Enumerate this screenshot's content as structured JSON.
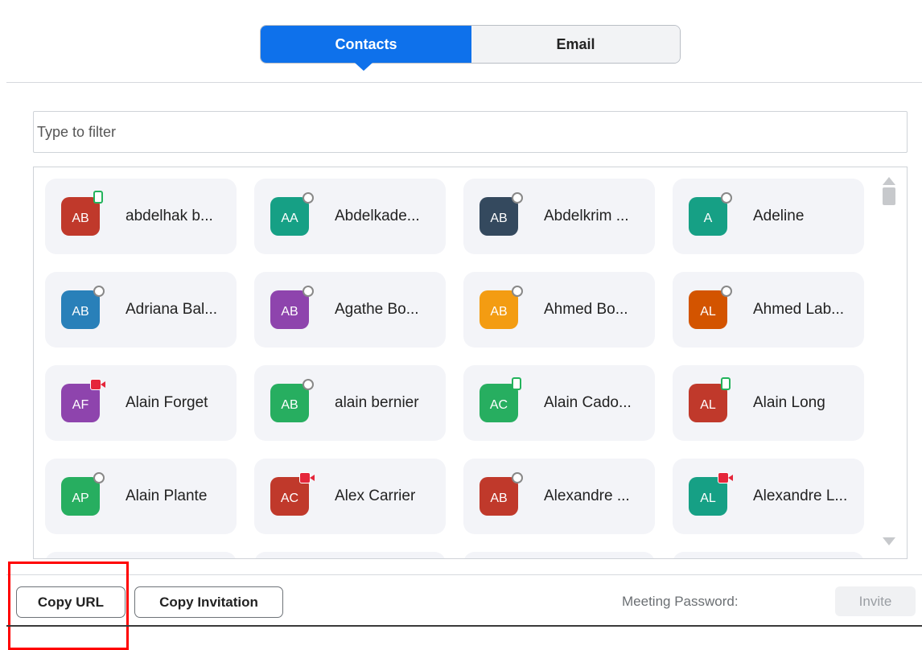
{
  "tabs": [
    {
      "label": "Contacts",
      "active": true
    },
    {
      "label": "Email",
      "active": false
    }
  ],
  "filter": {
    "placeholder": "Type to filter",
    "value": ""
  },
  "contacts": [
    {
      "initials": "AB",
      "name": "abdelhak b...",
      "color": "#c0392b",
      "status": "online"
    },
    {
      "initials": "AA",
      "name": "Abdelkade...",
      "color": "#16a085",
      "status": "offline"
    },
    {
      "initials": "AB",
      "name": "Abdelkrim ...",
      "color": "#34495e",
      "status": "offline"
    },
    {
      "initials": "A",
      "name": "Adeline",
      "color": "#16a085",
      "status": "offline"
    },
    {
      "initials": "AB",
      "name": "Adriana Bal...",
      "color": "#2980b9",
      "status": "offline"
    },
    {
      "initials": "AB",
      "name": "Agathe Bo...",
      "color": "#8e44ad",
      "status": "offline"
    },
    {
      "initials": "AB",
      "name": "Ahmed Bo...",
      "color": "#f39c12",
      "status": "offline"
    },
    {
      "initials": "AL",
      "name": "Ahmed Lab...",
      "color": "#d35400",
      "status": "offline"
    },
    {
      "initials": "AF",
      "name": "Alain  Forget",
      "color": "#8e44ad",
      "status": "video"
    },
    {
      "initials": "AB",
      "name": "alain bernier",
      "color": "#27ae60",
      "status": "offline"
    },
    {
      "initials": "AC",
      "name": "Alain Cado...",
      "color": "#27ae60",
      "status": "online"
    },
    {
      "initials": "AL",
      "name": "Alain Long",
      "color": "#c0392b",
      "status": "online"
    },
    {
      "initials": "AP",
      "name": "Alain Plante",
      "color": "#27ae60",
      "status": "offline"
    },
    {
      "initials": "AC",
      "name": "Alex Carrier",
      "color": "#c0392b",
      "status": "video"
    },
    {
      "initials": "AB",
      "name": "Alexandre ...",
      "color": "#c0392b",
      "status": "offline"
    },
    {
      "initials": "AL",
      "name": "Alexandre L...",
      "color": "#16a085",
      "status": "video"
    }
  ],
  "bottom": {
    "copy_url": "Copy URL",
    "copy_invitation": "Copy Invitation",
    "password_label": "Meeting Password:",
    "invite": "Invite"
  },
  "colors": {
    "accent": "#0e71eb",
    "highlight": "#ff0000"
  }
}
